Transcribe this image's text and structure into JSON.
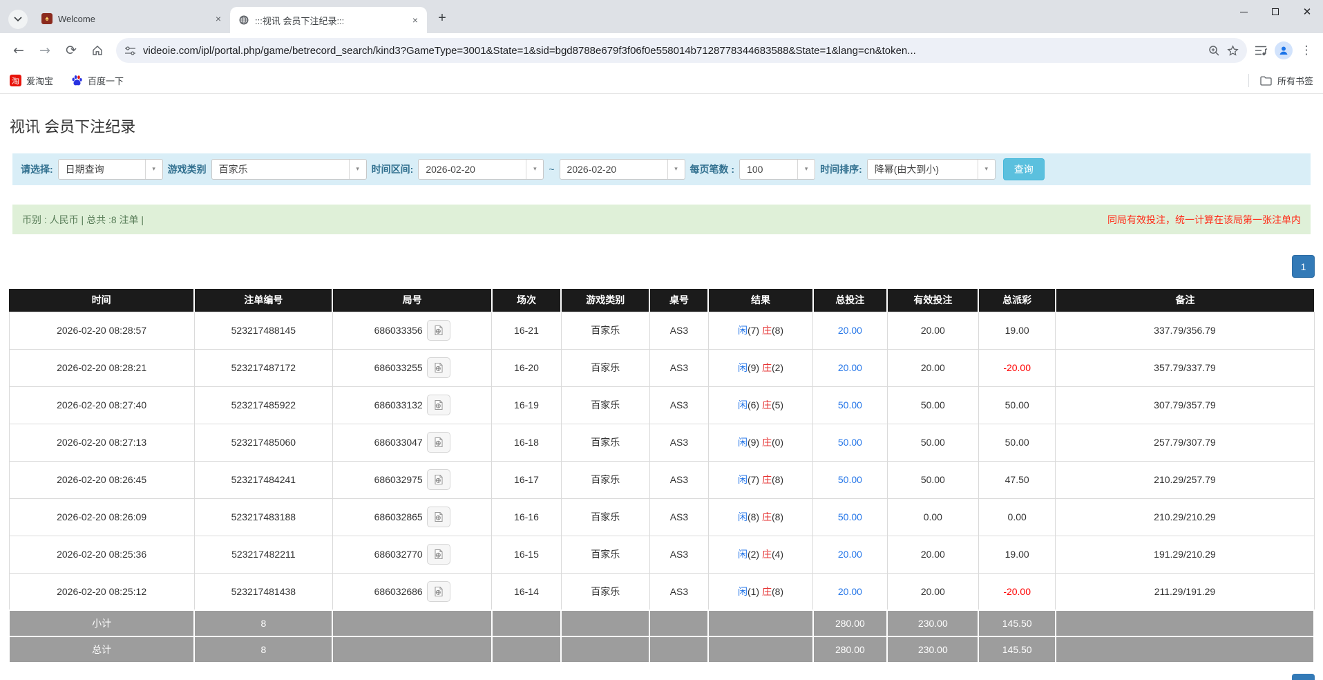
{
  "browser": {
    "tabs": [
      {
        "title": "Welcome",
        "active": false
      },
      {
        "title": ":::视讯 会员下注纪录:::",
        "active": true
      }
    ],
    "url": "videoie.com/ipl/portal.php/game/betrecord_search/kind3?GameType=3001&State=1&sid=bgd8788e679f3f06f0e558014b7128778344683588&State=1&lang=cn&token...",
    "bookmarks": [
      {
        "label": "爱淘宝",
        "icon_text": "淘"
      },
      {
        "label": "百度一下"
      }
    ],
    "all_bookmarks_label": "所有书签",
    "newtab_label": "+",
    "close_label": "×"
  },
  "page": {
    "title": "视讯 会员下注纪录",
    "filters": {
      "select_label": "请选择:",
      "select_value": "日期查询",
      "game_type_label": "游戏类别",
      "game_type_value": "百家乐",
      "date_range_label": "时间区间:",
      "date_from": "2026-02-20",
      "tilde": "~",
      "date_to": "2026-02-20",
      "page_size_label": "每页笔数 :",
      "page_size_value": "100",
      "sort_label": "时间排序:",
      "sort_value": "降幂(由大到小)",
      "search_button": "查询",
      "arrow_glyph": "▾"
    },
    "summary": {
      "left": "币别 : 人民币 | 总共 :8 注单 |",
      "right": "同局有效投注，统一计算在该局第一张注单内"
    },
    "pagination": {
      "current": "1"
    },
    "table": {
      "headers": [
        "时间",
        "注单编号",
        "局号",
        "场次",
        "游戏类别",
        "桌号",
        "结果",
        "总投注",
        "有效投注",
        "总派彩",
        "备注"
      ],
      "rows": [
        {
          "time": "2026-02-20 08:28:57",
          "bet_id": "523217488145",
          "round": "686033356",
          "session": "16-21",
          "game": "百家乐",
          "table_no": "AS3",
          "player": "闲",
          "player_num": "(7)",
          "banker": "庄",
          "banker_num": "(8)",
          "total_bet": "20.00",
          "valid_bet": "20.00",
          "payout": "19.00",
          "remark": "337.79/356.79"
        },
        {
          "time": "2026-02-20 08:28:21",
          "bet_id": "523217487172",
          "round": "686033255",
          "session": "16-20",
          "game": "百家乐",
          "table_no": "AS3",
          "player": "闲",
          "player_num": "(9)",
          "banker": "庄",
          "banker_num": "(2)",
          "total_bet": "20.00",
          "valid_bet": "20.00",
          "payout": "-20.00",
          "remark": "357.79/337.79"
        },
        {
          "time": "2026-02-20 08:27:40",
          "bet_id": "523217485922",
          "round": "686033132",
          "session": "16-19",
          "game": "百家乐",
          "table_no": "AS3",
          "player": "闲",
          "player_num": "(6)",
          "banker": "庄",
          "banker_num": "(5)",
          "total_bet": "50.00",
          "valid_bet": "50.00",
          "payout": "50.00",
          "remark": "307.79/357.79"
        },
        {
          "time": "2026-02-20 08:27:13",
          "bet_id": "523217485060",
          "round": "686033047",
          "session": "16-18",
          "game": "百家乐",
          "table_no": "AS3",
          "player": "闲",
          "player_num": "(9)",
          "banker": "庄",
          "banker_num": "(0)",
          "total_bet": "50.00",
          "valid_bet": "50.00",
          "payout": "50.00",
          "remark": "257.79/307.79"
        },
        {
          "time": "2026-02-20 08:26:45",
          "bet_id": "523217484241",
          "round": "686032975",
          "session": "16-17",
          "game": "百家乐",
          "table_no": "AS3",
          "player": "闲",
          "player_num": "(7)",
          "banker": "庄",
          "banker_num": "(8)",
          "total_bet": "50.00",
          "valid_bet": "50.00",
          "payout": "47.50",
          "remark": "210.29/257.79"
        },
        {
          "time": "2026-02-20 08:26:09",
          "bet_id": "523217483188",
          "round": "686032865",
          "session": "16-16",
          "game": "百家乐",
          "table_no": "AS3",
          "player": "闲",
          "player_num": "(8)",
          "banker": "庄",
          "banker_num": "(8)",
          "total_bet": "50.00",
          "valid_bet": "0.00",
          "payout": "0.00",
          "remark": "210.29/210.29"
        },
        {
          "time": "2026-02-20 08:25:36",
          "bet_id": "523217482211",
          "round": "686032770",
          "session": "16-15",
          "game": "百家乐",
          "table_no": "AS3",
          "player": "闲",
          "player_num": "(2)",
          "banker": "庄",
          "banker_num": "(4)",
          "total_bet": "20.00",
          "valid_bet": "20.00",
          "payout": "19.00",
          "remark": "191.29/210.29"
        },
        {
          "time": "2026-02-20 08:25:12",
          "bet_id": "523217481438",
          "round": "686032686",
          "session": "16-14",
          "game": "百家乐",
          "table_no": "AS3",
          "player": "闲",
          "player_num": "(1)",
          "banker": "庄",
          "banker_num": "(8)",
          "total_bet": "20.00",
          "valid_bet": "20.00",
          "payout": "-20.00",
          "remark": "211.29/191.29"
        }
      ],
      "subtotal": {
        "label": "小计",
        "count": "8",
        "total_bet": "280.00",
        "valid_bet": "230.00",
        "payout": "145.50"
      },
      "total": {
        "label": "总计",
        "count": "8",
        "total_bet": "280.00",
        "valid_bet": "230.00",
        "payout": "145.50"
      }
    }
  }
}
